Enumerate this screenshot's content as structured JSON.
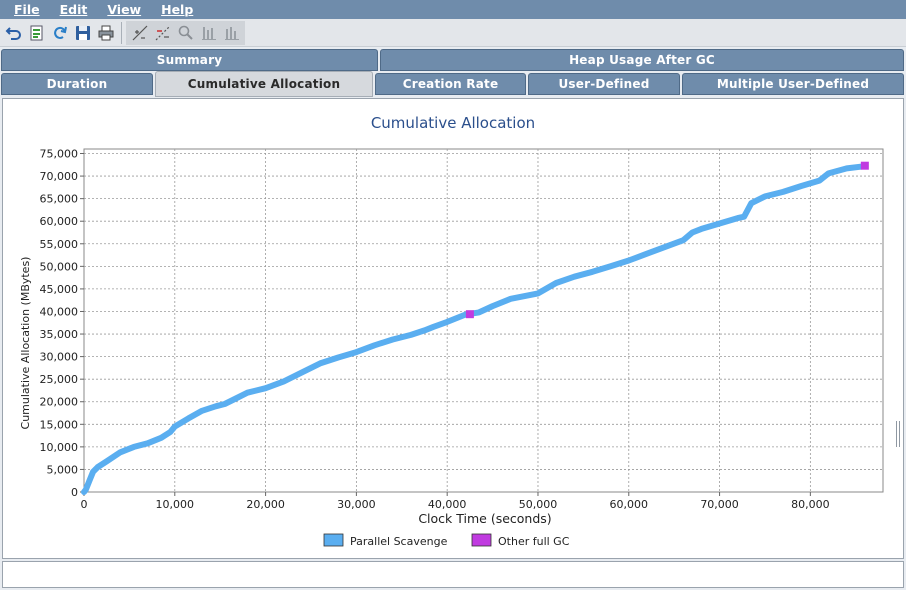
{
  "menu": {
    "items": [
      {
        "label": "File"
      },
      {
        "label": "Edit"
      },
      {
        "label": "View"
      },
      {
        "label": "Help"
      }
    ]
  },
  "toolbar": {
    "icons": [
      "undo-icon",
      "export-icon",
      "refresh-icon",
      "save-icon",
      "print-icon",
      "zoom-region-icon",
      "zoom-out-region-icon",
      "zoom-icon",
      "bar-chart-icon",
      "bar-chart-alt-icon"
    ]
  },
  "tabs": {
    "row1": [
      {
        "label": "Summary"
      },
      {
        "label": "Heap Usage After GC"
      }
    ],
    "row2": [
      {
        "label": "Duration"
      },
      {
        "label": "Cumulative Allocation",
        "active": true
      },
      {
        "label": "Creation Rate"
      },
      {
        "label": "User-Defined"
      },
      {
        "label": "Multiple User-Defined"
      }
    ]
  },
  "colors": {
    "title": "#2b4f8c",
    "series_scavenge": "#5aaef0",
    "series_fullgc": "#c03be0",
    "tab_bg": "#6f8cab"
  },
  "chart_data": {
    "type": "line",
    "title": "Cumulative Allocation",
    "xlabel": "Clock Time  (seconds)",
    "ylabel": "Cumulative Allocation  (MBytes)",
    "xlim": [
      0,
      88000
    ],
    "ylim": [
      0,
      76000
    ],
    "x_ticks": [
      "0",
      "10,000",
      "20,000",
      "30,000",
      "40,000",
      "50,000",
      "60,000",
      "70,000",
      "80,000"
    ],
    "x_tick_values": [
      0,
      10000,
      20000,
      30000,
      40000,
      50000,
      60000,
      70000,
      80000
    ],
    "y_ticks": [
      "0",
      "5,000",
      "10,000",
      "15,000",
      "20,000",
      "25,000",
      "30,000",
      "35,000",
      "40,000",
      "45,000",
      "50,000",
      "55,000",
      "60,000",
      "65,000",
      "70,000",
      "75,000"
    ],
    "y_tick_values": [
      0,
      5000,
      10000,
      15000,
      20000,
      25000,
      30000,
      35000,
      40000,
      45000,
      50000,
      55000,
      60000,
      65000,
      70000,
      75000
    ],
    "grid": true,
    "legend_position": "bottom",
    "series": [
      {
        "name": "Parallel Scavenge",
        "color": "#5aaef0",
        "x": [
          0,
          200,
          600,
          1000,
          1500,
          2500,
          4000,
          5500,
          7000,
          8500,
          9500,
          10000,
          11500,
          13000,
          14500,
          15500,
          16500,
          18000,
          20000,
          22000,
          24000,
          26000,
          28000,
          30000,
          32000,
          34000,
          36000,
          37500,
          38500,
          40000,
          42000,
          43500,
          45000,
          47000,
          50000,
          52000,
          54000,
          56000,
          58000,
          60000,
          62000,
          64000,
          66000,
          67000,
          68000,
          70000,
          72000,
          72700,
          73500,
          75000,
          77000,
          79000,
          81000,
          82000,
          84000,
          86000
        ],
        "y": [
          0,
          500,
          2500,
          4500,
          5500,
          6800,
          8800,
          10000,
          10800,
          12000,
          13300,
          14500,
          16300,
          18000,
          19000,
          19500,
          20500,
          22000,
          23000,
          24500,
          26500,
          28500,
          29800,
          31000,
          32500,
          33800,
          34800,
          35800,
          36600,
          37700,
          39300,
          39800,
          41200,
          42800,
          44000,
          46300,
          47700,
          48800,
          50000,
          51300,
          52800,
          54300,
          55800,
          57500,
          58300,
          59500,
          60700,
          61000,
          64000,
          65500,
          66500,
          67800,
          69000,
          70600,
          71700,
          72200
        ]
      },
      {
        "name": "Other full GC",
        "color": "#c03be0",
        "x": [
          42500,
          86000
        ],
        "y": [
          39400,
          72300
        ]
      }
    ]
  }
}
